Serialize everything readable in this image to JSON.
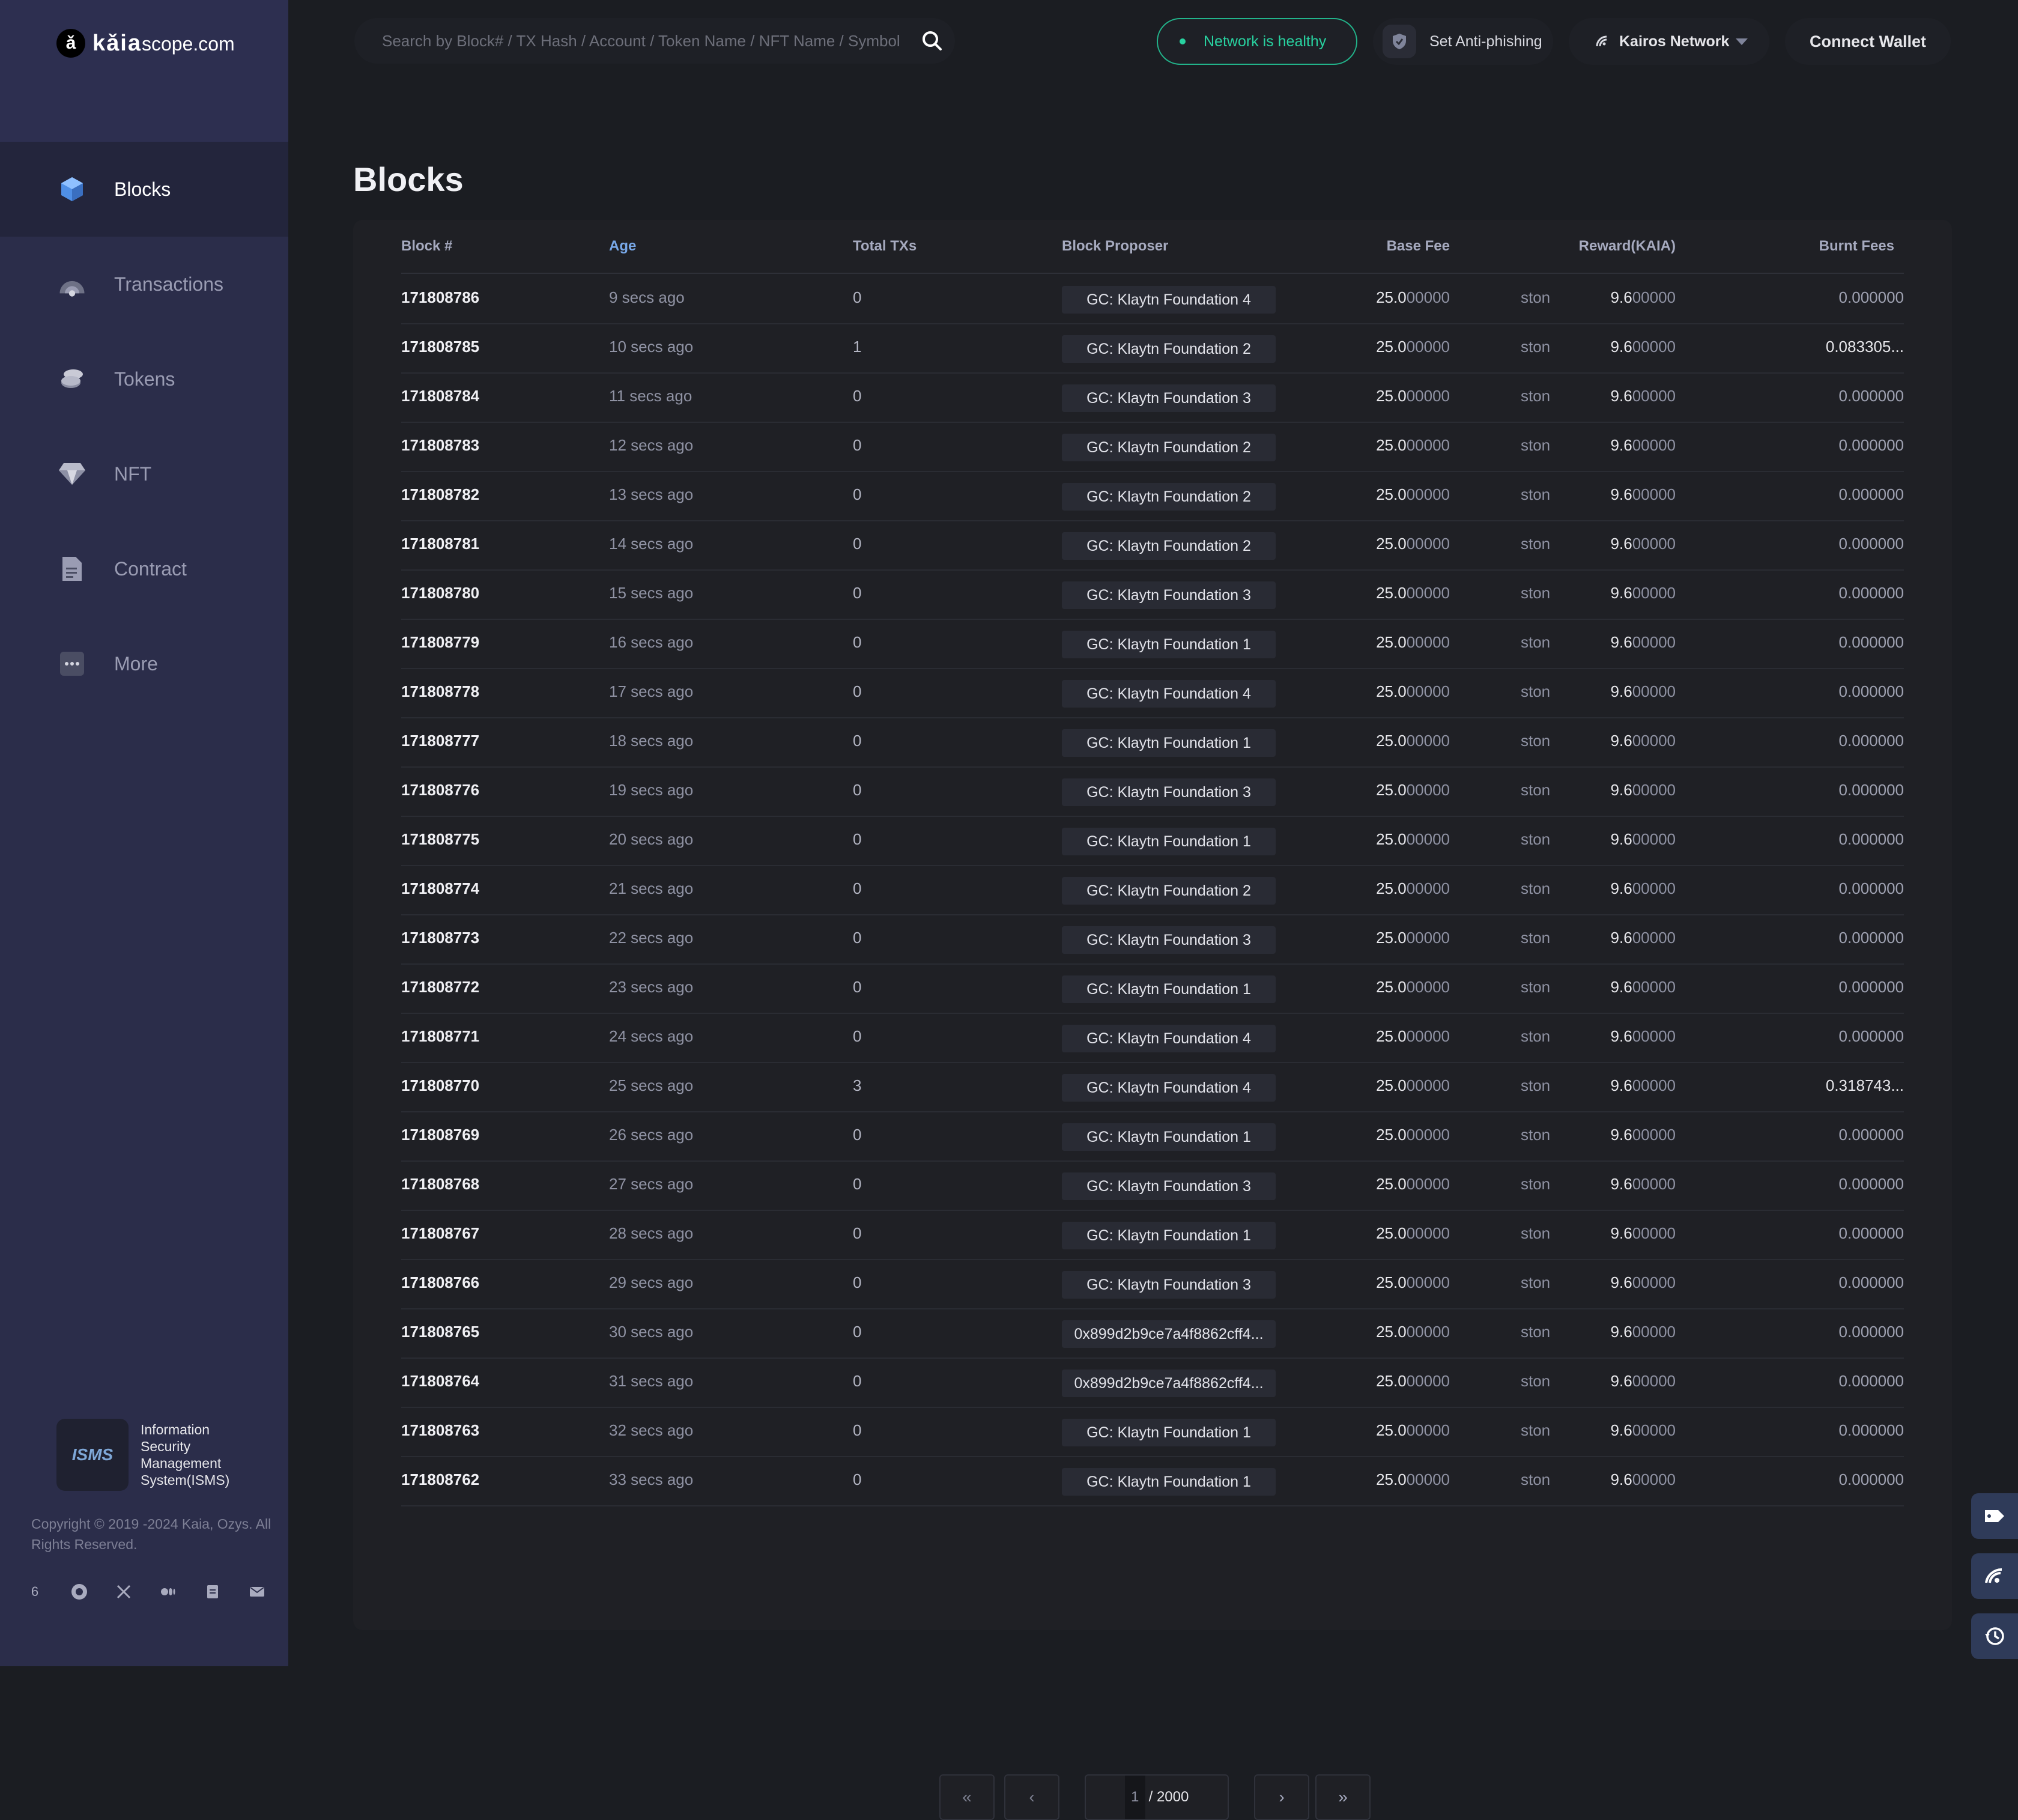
{
  "brand": {
    "mark": "ǎ",
    "name_bold": "kǎia",
    "name_light": "scope.com"
  },
  "sidebar": {
    "items": [
      {
        "label": "Blocks",
        "icon": "cube-icon",
        "active": true
      },
      {
        "label": "Transactions",
        "icon": "transactions-icon",
        "active": false
      },
      {
        "label": "Tokens",
        "icon": "coins-icon",
        "active": false
      },
      {
        "label": "NFT",
        "icon": "diamond-icon",
        "active": false
      },
      {
        "label": "Contract",
        "icon": "document-icon",
        "active": false
      },
      {
        "label": "More",
        "icon": "more-icon",
        "active": false
      }
    ],
    "isms": {
      "badge": "ISMS",
      "text": "Information Security Management System(ISMS)"
    },
    "copyright": "Copyright © 2019 -2024 Kaia, Ozys. All Rights Reserved.",
    "socials": [
      "6",
      "github-icon",
      "x-icon",
      "medium-icon",
      "docs-icon",
      "mail-icon"
    ]
  },
  "header": {
    "search_placeholder": "Search by Block# / TX Hash / Account / Token Name / NFT Name / Symbol",
    "status": "Network is healthy",
    "antiphishing": "Set Anti-phishing",
    "network": "Kairos Network",
    "wallet": "Connect Wallet"
  },
  "page": {
    "title": "Blocks"
  },
  "table": {
    "columns": {
      "block": "Block #",
      "age": "Age",
      "txs": "Total TXs",
      "proposer": "Block Proposer",
      "base_fee": "Base Fee",
      "reward": "Reward(KAIA)",
      "burnt": "Burnt Fees"
    },
    "base_fee_main": "25.0",
    "base_fee_dim": "00000",
    "base_fee_unit": "ston",
    "reward_main": "9.6",
    "reward_dim": "00000",
    "rows": [
      {
        "block": "171808786",
        "age": "9 secs ago",
        "txs": "0",
        "proposer": "GC: Klaytn Foundation 4",
        "burnt": "0.000000"
      },
      {
        "block": "171808785",
        "age": "10 secs ago",
        "txs": "1",
        "proposer": "GC: Klaytn Foundation 2",
        "burnt": "0.083305..."
      },
      {
        "block": "171808784",
        "age": "11 secs ago",
        "txs": "0",
        "proposer": "GC: Klaytn Foundation 3",
        "burnt": "0.000000"
      },
      {
        "block": "171808783",
        "age": "12 secs ago",
        "txs": "0",
        "proposer": "GC: Klaytn Foundation 2",
        "burnt": "0.000000"
      },
      {
        "block": "171808782",
        "age": "13 secs ago",
        "txs": "0",
        "proposer": "GC: Klaytn Foundation 2",
        "burnt": "0.000000"
      },
      {
        "block": "171808781",
        "age": "14 secs ago",
        "txs": "0",
        "proposer": "GC: Klaytn Foundation 2",
        "burnt": "0.000000"
      },
      {
        "block": "171808780",
        "age": "15 secs ago",
        "txs": "0",
        "proposer": "GC: Klaytn Foundation 3",
        "burnt": "0.000000"
      },
      {
        "block": "171808779",
        "age": "16 secs ago",
        "txs": "0",
        "proposer": "GC: Klaytn Foundation 1",
        "burnt": "0.000000"
      },
      {
        "block": "171808778",
        "age": "17 secs ago",
        "txs": "0",
        "proposer": "GC: Klaytn Foundation 4",
        "burnt": "0.000000"
      },
      {
        "block": "171808777",
        "age": "18 secs ago",
        "txs": "0",
        "proposer": "GC: Klaytn Foundation 1",
        "burnt": "0.000000"
      },
      {
        "block": "171808776",
        "age": "19 secs ago",
        "txs": "0",
        "proposer": "GC: Klaytn Foundation 3",
        "burnt": "0.000000"
      },
      {
        "block": "171808775",
        "age": "20 secs ago",
        "txs": "0",
        "proposer": "GC: Klaytn Foundation 1",
        "burnt": "0.000000"
      },
      {
        "block": "171808774",
        "age": "21 secs ago",
        "txs": "0",
        "proposer": "GC: Klaytn Foundation 2",
        "burnt": "0.000000"
      },
      {
        "block": "171808773",
        "age": "22 secs ago",
        "txs": "0",
        "proposer": "GC: Klaytn Foundation 3",
        "burnt": "0.000000"
      },
      {
        "block": "171808772",
        "age": "23 secs ago",
        "txs": "0",
        "proposer": "GC: Klaytn Foundation 1",
        "burnt": "0.000000"
      },
      {
        "block": "171808771",
        "age": "24 secs ago",
        "txs": "0",
        "proposer": "GC: Klaytn Foundation 4",
        "burnt": "0.000000"
      },
      {
        "block": "171808770",
        "age": "25 secs ago",
        "txs": "3",
        "proposer": "GC: Klaytn Foundation 4",
        "burnt": "0.318743..."
      },
      {
        "block": "171808769",
        "age": "26 secs ago",
        "txs": "0",
        "proposer": "GC: Klaytn Foundation 1",
        "burnt": "0.000000"
      },
      {
        "block": "171808768",
        "age": "27 secs ago",
        "txs": "0",
        "proposer": "GC: Klaytn Foundation 3",
        "burnt": "0.000000"
      },
      {
        "block": "171808767",
        "age": "28 secs ago",
        "txs": "0",
        "proposer": "GC: Klaytn Foundation 1",
        "burnt": "0.000000"
      },
      {
        "block": "171808766",
        "age": "29 secs ago",
        "txs": "0",
        "proposer": "GC: Klaytn Foundation 3",
        "burnt": "0.000000"
      },
      {
        "block": "171808765",
        "age": "30 secs ago",
        "txs": "0",
        "proposer": "0x899d2b9ce7a4f8862cff4...",
        "burnt": "0.000000"
      },
      {
        "block": "171808764",
        "age": "31 secs ago",
        "txs": "0",
        "proposer": "0x899d2b9ce7a4f8862cff4...",
        "burnt": "0.000000"
      },
      {
        "block": "171808763",
        "age": "32 secs ago",
        "txs": "0",
        "proposer": "GC: Klaytn Foundation 1",
        "burnt": "0.000000"
      },
      {
        "block": "171808762",
        "age": "33 secs ago",
        "txs": "0",
        "proposer": "GC: Klaytn Foundation 1",
        "burnt": "0.000000"
      }
    ]
  },
  "pagination": {
    "current": "1",
    "total": "/ 2000",
    "first": "«",
    "prev": "‹",
    "next": "›",
    "last": "»"
  },
  "floating": [
    "tag-icon",
    "rss-icon",
    "history-icon"
  ],
  "colors": {
    "sidebar": "#2b2d4a",
    "background": "#1b1d22",
    "healthy": "#28d2a0",
    "accent": "#78a8e8"
  }
}
